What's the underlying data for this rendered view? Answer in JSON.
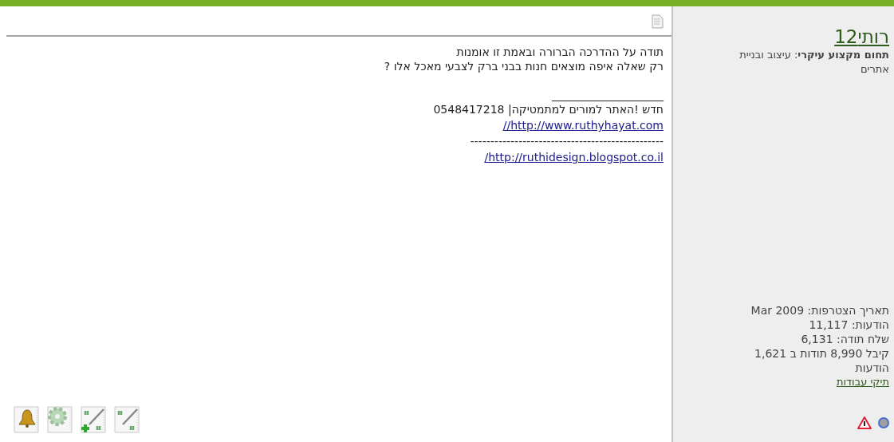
{
  "post": {
    "message": [
      "תודה על ההדרכה הברורה ובאמת זו אומנות",
      "רק שאלה איפה מוצאים חנות בבני ברק לצבעי מאכל אלו ?"
    ],
    "signature": [
      {
        "kind": "text",
        "text": "____________________"
      },
      {
        "kind": "text",
        "text": "חדש !האתר למורים למתמטיקה| 0548417218"
      },
      {
        "kind": "link",
        "text": "//http://www.ruthyhayat.com"
      },
      {
        "kind": "text",
        "text": "------------------------------------------------"
      },
      {
        "kind": "link",
        "text": "/http://ruthidesign.blogspot.co.il"
      }
    ]
  },
  "user": {
    "name": "רותי12",
    "profession": "**תחום מקצוע עיקרי**: עיצוב ובניית אתרים",
    "stats": [
      "תאריך הצטרפות: Mar 2009",
      "הודעות: 11,117",
      "שלח תודה: 6,131",
      "קיבל 8,990 תודות ב 1,621 הודעות"
    ],
    "portfolio_link": "תיקי עבודות",
    "online": false
  }
}
